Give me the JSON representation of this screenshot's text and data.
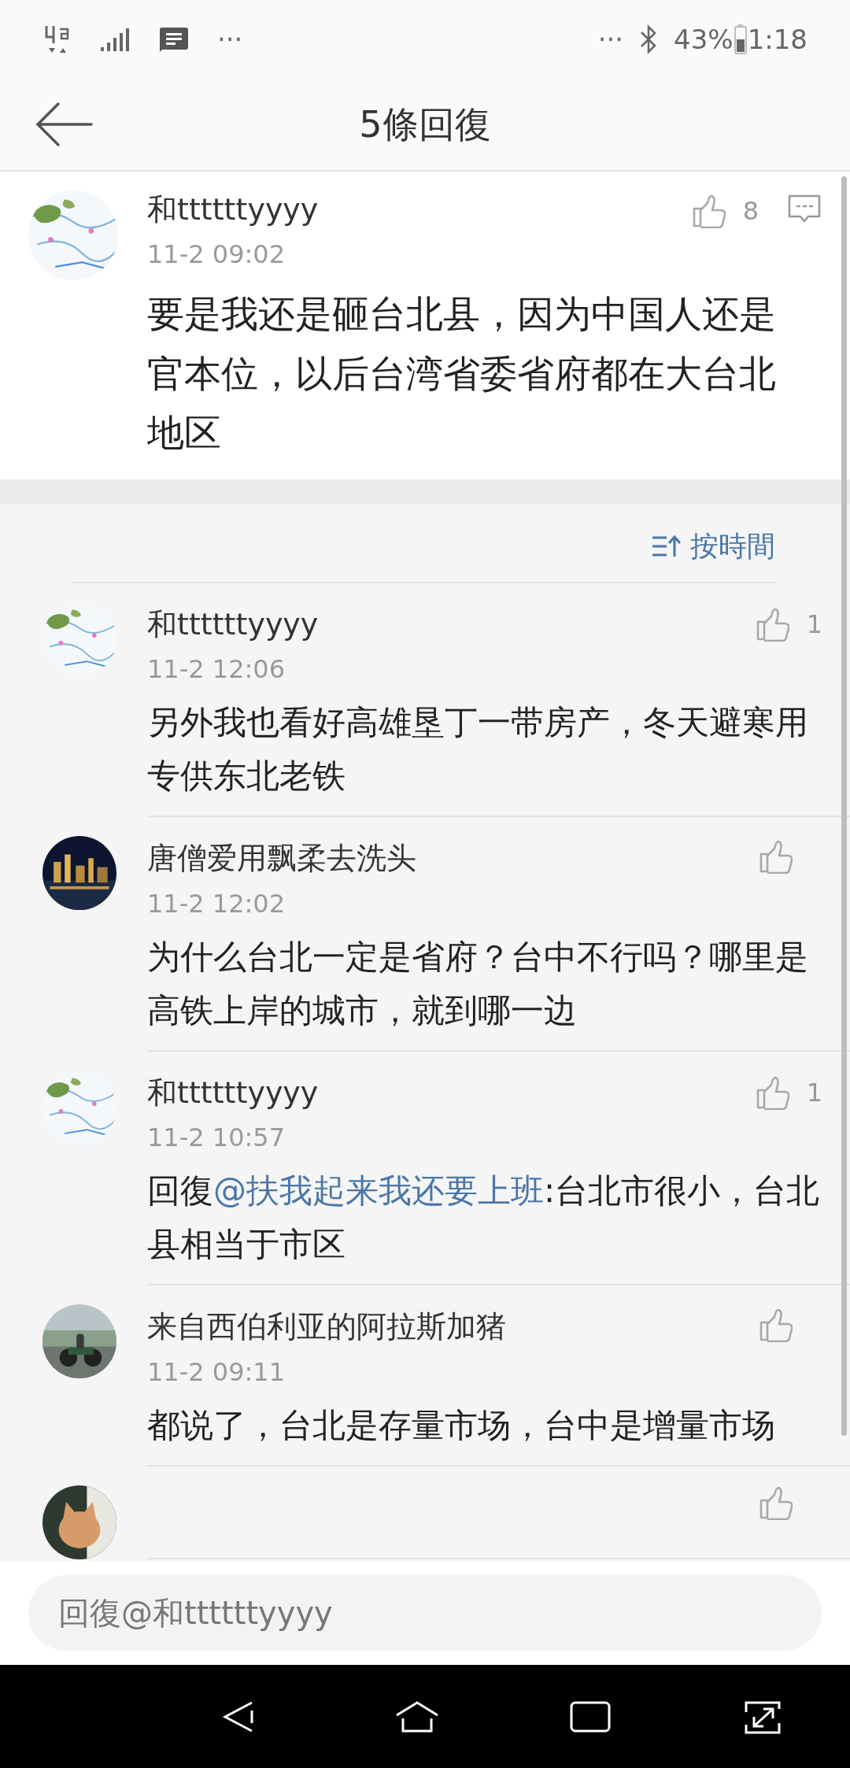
{
  "status_bar": {
    "more_left": "···",
    "more_right": "···",
    "battery": "43%",
    "time": "1:18"
  },
  "header": {
    "title": "5條回復"
  },
  "post": {
    "author": "和ttttttyyyy",
    "time": "11-2 09:02",
    "likes": "8",
    "content": "要是我还是砸台北县，因为中国人还是官本位，以后台湾省委省府都在大台北地区"
  },
  "sort": {
    "label": "按時間"
  },
  "replies": [
    {
      "kind": "full",
      "author": "和ttttttyyyy",
      "time": "11-2 12:06",
      "likes": "1",
      "content": [
        {
          "kind": "text",
          "text": "另外我也看好高雄垦丁一带房产，冬天避寒用专供东北老铁"
        }
      ]
    },
    {
      "kind": "full",
      "author": "唐僧爱用飘柔去洗头",
      "time": "11-2 12:02",
      "content": [
        {
          "kind": "text",
          "text": "为什么台北一定是省府？台中不行吗？哪里是高铁上岸的城市，就到哪一边"
        }
      ]
    },
    {
      "kind": "full",
      "author": "和ttttttyyyy",
      "time": "11-2 10:57",
      "likes": "1",
      "content": [
        {
          "kind": "text",
          "text": "回復"
        },
        {
          "kind": "mention",
          "text": "@扶我起来我还要上班"
        },
        {
          "kind": "text",
          "text": ":台北市很小，台北县相当于市区"
        }
      ]
    },
    {
      "kind": "full",
      "author": "来自西伯利亚的阿拉斯加猪",
      "time": "11-2 09:11",
      "content": [
        {
          "kind": "text",
          "text": "都说了，台北是存量市场，台中是增量市场"
        }
      ]
    },
    {
      "kind": "partial"
    }
  ],
  "input": {
    "placeholder": "回復@和ttttttyyyy"
  }
}
